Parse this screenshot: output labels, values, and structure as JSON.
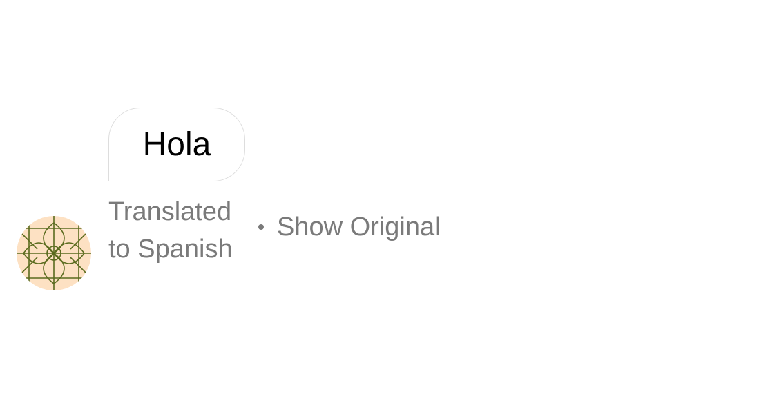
{
  "message": {
    "text": "Hola"
  },
  "translation": {
    "status_line1": "Translated",
    "status_line2": "to Spanish",
    "separator": "•",
    "show_original_label": "Show Original"
  },
  "avatar": {
    "icon": "geometric-pattern-avatar",
    "background_color": "#fde1c3",
    "line_color": "#5a6b1e"
  },
  "colors": {
    "secondary_text": "#7a7a7a",
    "bubble_border": "#dddddd"
  }
}
